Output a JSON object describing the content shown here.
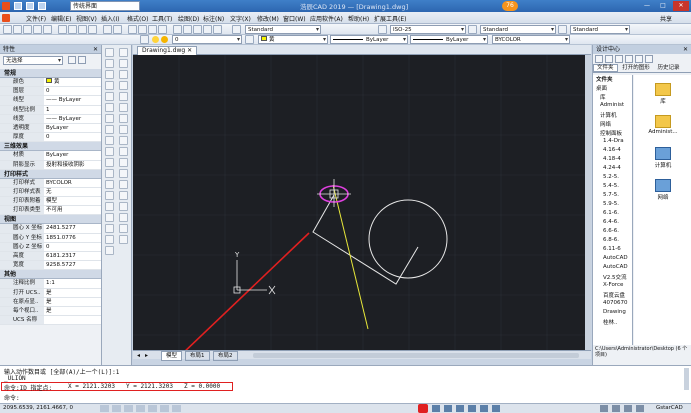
{
  "window": {
    "title": "浩辰CAD 2019 — [Drawing1.dwg]",
    "workspace": "传统界面",
    "badge": "76"
  },
  "menu": [
    "文件(F)",
    "编辑(E)",
    "视图(V)",
    "插入(I)",
    "格式(O)",
    "工具(T)",
    "绘图(D)",
    "标注(N)",
    "文字(X)",
    "修改(M)",
    "窗口(W)",
    "应用软件(A)",
    "帮助(H)",
    "扩展工具(E)",
    "共享"
  ],
  "toolbar": {
    "text_style": "Standard",
    "dim_style": "ISO-25",
    "table_style": "Standard",
    "multileader_style": "Standard",
    "layer": "0",
    "color": "黄",
    "linetype": "ByLayer",
    "lineweight": "ByLayer",
    "plotstyle": "BYCOLOR"
  },
  "properties": {
    "title": "特性",
    "selection": "无选择",
    "sections": [
      {
        "name": "常规",
        "rows": [
          {
            "k": "颜色",
            "v": "黄"
          },
          {
            "k": "图层",
            "v": "0"
          },
          {
            "k": "线型",
            "v": "—— ByLayer"
          },
          {
            "k": "线型比例",
            "v": "1"
          },
          {
            "k": "线宽",
            "v": "—— ByLayer"
          },
          {
            "k": "透明度",
            "v": "ByLayer"
          },
          {
            "k": "厚度",
            "v": "0"
          }
        ]
      },
      {
        "name": "三维效果",
        "rows": [
          {
            "k": "材质",
            "v": "ByLayer"
          },
          {
            "k": "阴影显示",
            "v": "投射和接收阴影"
          }
        ]
      },
      {
        "name": "打印样式",
        "rows": [
          {
            "k": "打印样式",
            "v": "BYCOLOR"
          },
          {
            "k": "打印样式表",
            "v": "无"
          },
          {
            "k": "打印表附着",
            "v": "模型"
          },
          {
            "k": "打印表类型",
            "v": "不可用"
          }
        ]
      },
      {
        "name": "视图",
        "rows": [
          {
            "k": "圆心 X 坐标",
            "v": "2481.5277"
          },
          {
            "k": "圆心 Y 坐标",
            "v": "1851.0776"
          },
          {
            "k": "圆心 Z 坐标",
            "v": "0"
          },
          {
            "k": "高度",
            "v": "6181.2317"
          },
          {
            "k": "宽度",
            "v": "9258.5727"
          }
        ]
      },
      {
        "name": "其他",
        "rows": [
          {
            "k": "注释比例",
            "v": "1:1"
          },
          {
            "k": "打开 UCS..",
            "v": "是"
          },
          {
            "k": "在原点显..",
            "v": "是"
          },
          {
            "k": "每个视口..",
            "v": "是"
          },
          {
            "k": "UCS 名称",
            "v": ""
          }
        ]
      }
    ]
  },
  "doc_tab": "Drawing1.dwg",
  "layout_tabs": [
    "模型",
    "布局1",
    "布局2"
  ],
  "design_center": {
    "title": "设计中心",
    "tab_folders": "文件夹",
    "tab_open": "打开的图形",
    "tab_history": "历史记录",
    "tree": [
      "文件夹",
      "桌面",
      "库",
      "Administ",
      "计算机",
      "网络",
      "控制面板",
      "1.4-Dra",
      "4.16-4",
      "4.18-4",
      "4.24-4",
      "5.2-5.",
      "5.4-5.",
      "5.7-5.",
      "5.9-5.",
      "6.1-6.",
      "6.4-6.",
      "6.6-6.",
      "6.8-6.",
      "6.11-6",
      "AutoCAD",
      "AutoCAD",
      "V2.5交流",
      "X-Force",
      "百度云盘",
      "4070670",
      "Drawing",
      "桂林.."
    ],
    "icons": [
      "库",
      "Administ...",
      "计算机",
      "网络"
    ],
    "path": "C:\\Users\\Administrator\\Desktop (6 个项目)"
  },
  "command": {
    "history1": "输入动作数目或 [全部(A)/上一个(L)]:1",
    "history2": "_ULION",
    "prompt_label": "命令:ID 指定点:",
    "x_value": "X = 2121.3203",
    "y_value": "Y = 2121.3203",
    "z_value": "Z = 0.0000",
    "input_label": "命令:"
  },
  "status": {
    "coords": "2095.6539, 2161.4667, 0",
    "app": "GstarCAD"
  },
  "ucs": {
    "x": "X",
    "y": "Y"
  },
  "colors": {
    "accent": "#2d66b0",
    "canvas": "#1d1f24",
    "highlight_box": "#e02020",
    "circle_select": "#e040e0",
    "yellow": "#e8e83a"
  }
}
